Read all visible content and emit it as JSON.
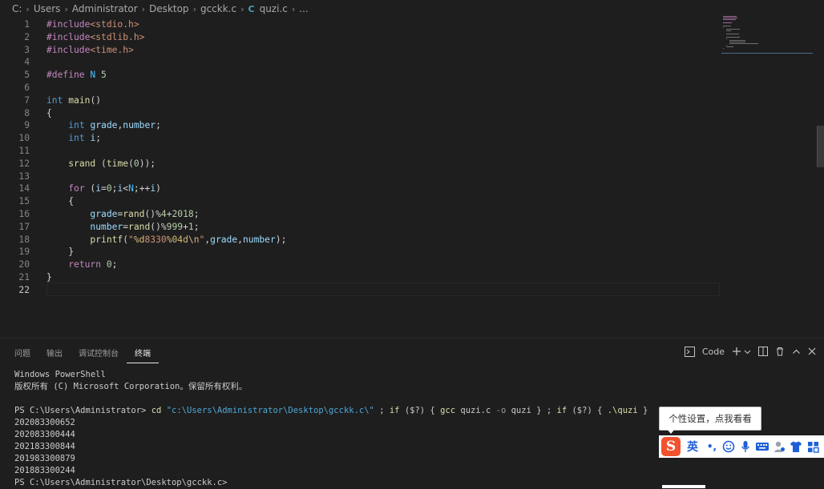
{
  "breadcrumb": [
    "C:",
    "Users",
    "Administrator",
    "Desktop",
    "gcckk.c",
    "quzi.c",
    "..."
  ],
  "breadcrumb_file_icon": "C",
  "code_lines": [
    {
      "n": "1",
      "tokens": [
        [
          "pre",
          "#include"
        ],
        [
          "inc",
          "<stdio.h>"
        ]
      ]
    },
    {
      "n": "2",
      "tokens": [
        [
          "pre",
          "#include"
        ],
        [
          "inc",
          "<stdlib.h>"
        ]
      ]
    },
    {
      "n": "3",
      "tokens": [
        [
          "pre",
          "#include"
        ],
        [
          "inc",
          "<time.h>"
        ]
      ]
    },
    {
      "n": "4",
      "tokens": []
    },
    {
      "n": "5",
      "tokens": [
        [
          "pre",
          "#define"
        ],
        [
          "",
          " "
        ],
        [
          "mac",
          "N"
        ],
        [
          "",
          " "
        ],
        [
          "num",
          "5"
        ]
      ]
    },
    {
      "n": "6",
      "tokens": []
    },
    {
      "n": "7",
      "tokens": [
        [
          "kw",
          "int"
        ],
        [
          "",
          " "
        ],
        [
          "fn",
          "main"
        ],
        [
          "",
          "()"
        ]
      ]
    },
    {
      "n": "8",
      "tokens": [
        [
          "",
          "{"
        ]
      ]
    },
    {
      "n": "9",
      "tokens": [
        [
          "",
          "    "
        ],
        [
          "kw",
          "int"
        ],
        [
          "",
          " "
        ],
        [
          "var",
          "grade"
        ],
        [
          "",
          ","
        ],
        [
          "var",
          "number"
        ],
        [
          "",
          ";"
        ]
      ]
    },
    {
      "n": "10",
      "tokens": [
        [
          "",
          "    "
        ],
        [
          "kw",
          "int"
        ],
        [
          "",
          " "
        ],
        [
          "var",
          "i"
        ],
        [
          "",
          ";"
        ]
      ]
    },
    {
      "n": "11",
      "tokens": []
    },
    {
      "n": "12",
      "tokens": [
        [
          "",
          "    "
        ],
        [
          "fn",
          "srand"
        ],
        [
          "",
          " ("
        ],
        [
          "fn",
          "time"
        ],
        [
          "",
          "("
        ],
        [
          "num",
          "0"
        ],
        [
          "",
          "));"
        ]
      ]
    },
    {
      "n": "13",
      "tokens": []
    },
    {
      "n": "14",
      "tokens": [
        [
          "",
          "    "
        ],
        [
          "ctl",
          "for"
        ],
        [
          "",
          " ("
        ],
        [
          "var",
          "i"
        ],
        [
          "",
          "="
        ],
        [
          "num",
          "0"
        ],
        [
          "",
          ";"
        ],
        [
          "var",
          "i"
        ],
        [
          "",
          "<"
        ],
        [
          "mac",
          "N"
        ],
        [
          "",
          ";++"
        ],
        [
          "var",
          "i"
        ],
        [
          "",
          ")"
        ]
      ]
    },
    {
      "n": "15",
      "tokens": [
        [
          "",
          "    {"
        ]
      ]
    },
    {
      "n": "16",
      "tokens": [
        [
          "",
          "        "
        ],
        [
          "var",
          "grade"
        ],
        [
          "",
          "="
        ],
        [
          "fn",
          "rand"
        ],
        [
          "",
          "()%"
        ],
        [
          "num",
          "4"
        ],
        [
          "",
          "+"
        ],
        [
          "num",
          "2018"
        ],
        [
          "",
          ";"
        ]
      ]
    },
    {
      "n": "17",
      "tokens": [
        [
          "",
          "        "
        ],
        [
          "var",
          "number"
        ],
        [
          "",
          "="
        ],
        [
          "fn",
          "rand"
        ],
        [
          "",
          "()%"
        ],
        [
          "num",
          "999"
        ],
        [
          "",
          "+"
        ],
        [
          "num",
          "1"
        ],
        [
          "",
          ";"
        ]
      ]
    },
    {
      "n": "18",
      "tokens": [
        [
          "",
          "        "
        ],
        [
          "fn",
          "printf"
        ],
        [
          "",
          "("
        ],
        [
          "str",
          "\""
        ],
        [
          "esc",
          "%d"
        ],
        [
          "str",
          "8330"
        ],
        [
          "esc",
          "%04d"
        ],
        [
          "esc",
          "\\n"
        ],
        [
          "str",
          "\""
        ],
        [
          "",
          ","
        ],
        [
          "var",
          "grade"
        ],
        [
          "",
          ","
        ],
        [
          "var",
          "number"
        ],
        [
          "",
          ");"
        ]
      ]
    },
    {
      "n": "19",
      "tokens": [
        [
          "",
          "    }"
        ]
      ]
    },
    {
      "n": "20",
      "tokens": [
        [
          "",
          "    "
        ],
        [
          "ctl",
          "return"
        ],
        [
          "",
          " "
        ],
        [
          "num",
          "0"
        ],
        [
          "",
          ";"
        ]
      ]
    },
    {
      "n": "21",
      "tokens": [
        [
          "",
          "}"
        ]
      ]
    },
    {
      "n": "22",
      "tokens": [],
      "active": true
    }
  ],
  "panel": {
    "tabs": [
      "问题",
      "输出",
      "调试控制台",
      "终端"
    ],
    "active_tab": "终端",
    "terminal_name": "Code",
    "icons": [
      "terminal-icon",
      "plus-icon",
      "chevron-down-icon",
      "split-icon",
      "trash-icon",
      "chevron-up-icon",
      "close-icon"
    ]
  },
  "terminal": {
    "header_1": "Windows PowerShell",
    "header_2": "版权所有 (C) Microsoft Corporation。保留所有权利。",
    "prompt_1": "PS C:\\Users\\Administrator>",
    "command": {
      "cd": "cd",
      "path": "\"c:\\Users\\Administrator\\Desktop\\gcckk.c\\\"",
      "rest_1": " ; ",
      "if1": "if",
      "rest_2": " ($?) { ",
      "gcc": "gcc",
      "rest_3": " quzi.c ",
      "flag": "-o",
      "rest_4": " quzi } ; ",
      "if2": "if",
      "rest_5": " ($?) { ",
      "run": ".\\quzi",
      "rest_6": " }"
    },
    "output": [
      "202083300652",
      "202083300444",
      "202183300844",
      "201983300879",
      "201883300244"
    ],
    "prompt_2": "PS C:\\Users\\Administrator\\Desktop\\gcckk.c>"
  },
  "ime": {
    "tooltip": "个性设置，点我看看",
    "logo": "S",
    "lang": "英",
    "punct": "•,",
    "icons": [
      "smile-icon",
      "microphone-icon",
      "keyboard-icon",
      "user-icon",
      "shirt-icon",
      "grid-icon"
    ]
  },
  "colors": {
    "background": "#1e1e1e",
    "keyword": "#569cd6",
    "preprocessor": "#c586c0",
    "function": "#dcdcaa",
    "variable": "#9cdcfe",
    "number": "#b5cea8",
    "string": "#ce9178",
    "ime_logo": "#f2522e"
  }
}
